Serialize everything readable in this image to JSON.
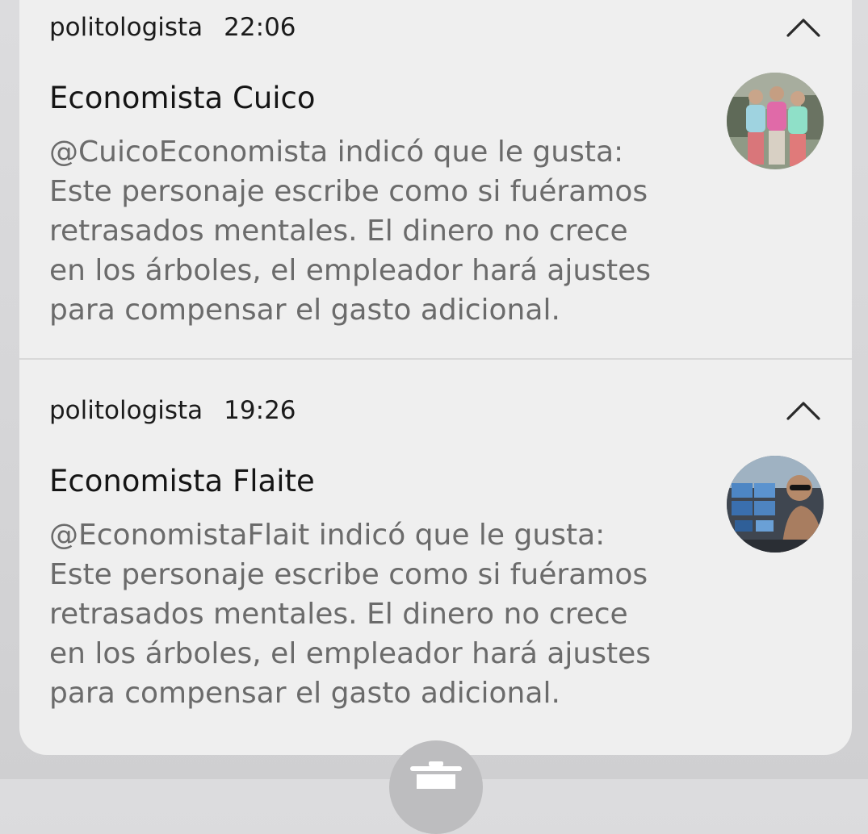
{
  "notifications": [
    {
      "app": "politologista",
      "time": "22:06",
      "sender": "Economista Cuico",
      "lines": [
        "@CuicoEconomista indicó que le gusta:",
        "Este personaje escribe como si fuéramos",
        "retrasados mentales. El dinero no crece",
        "en los árboles, el empleador hará ajustes",
        "para compensar el gasto adicional."
      ],
      "expanded": true,
      "avatar_icon": "group-photo-avatar"
    },
    {
      "app": "politologista",
      "time": "19:26",
      "sender": "Economista Flaite",
      "lines": [
        "@EconomistaFlait indicó que le gusta:",
        "Este personaje escribe como si fuéramos",
        "retrasados mentales. El dinero no crece",
        "en los árboles, el empleador hará ajustes",
        "para compensar el gasto adicional."
      ],
      "expanded": true,
      "avatar_icon": "trading-desk-photo-avatar"
    }
  ],
  "actions": {
    "clear_icon": "trash-icon"
  },
  "colors": {
    "panel": "#efefef",
    "title": "#151515",
    "body": "#6b6b6b"
  }
}
